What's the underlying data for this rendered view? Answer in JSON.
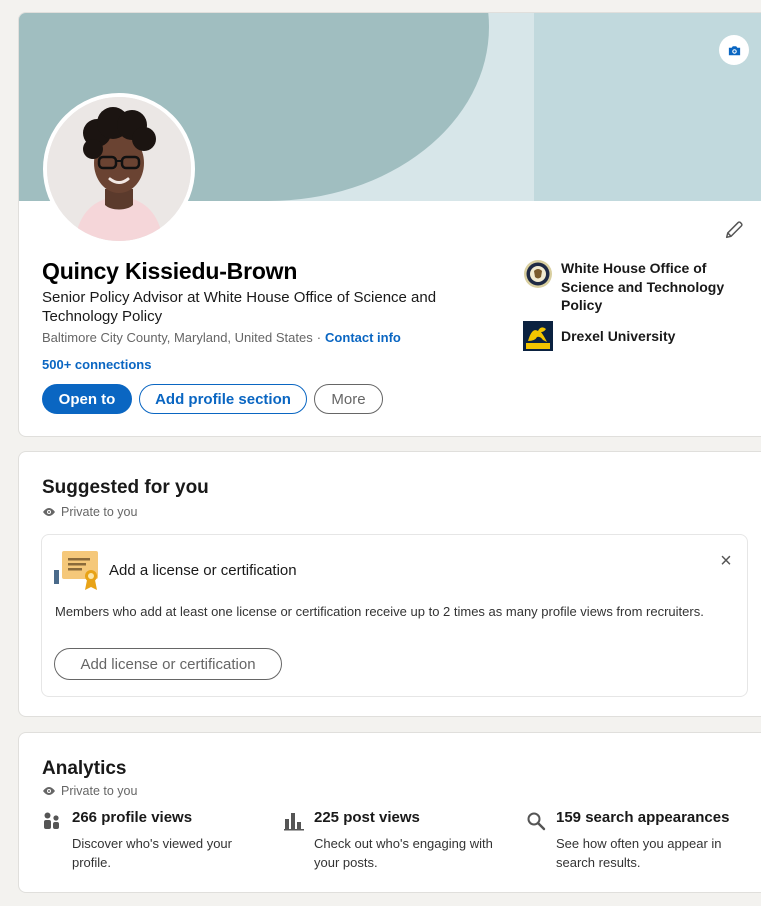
{
  "profile": {
    "name": "Quincy Kissiedu-Brown",
    "headline": "Senior Policy Advisor at White House Office of Science and Technology Policy",
    "location": "Baltimore City County, Maryland, United States",
    "separator": "·",
    "contact_info": "Contact info",
    "connections": "500+ connections",
    "buttons": {
      "open_to": "Open to",
      "add_section": "Add profile section",
      "more": "More"
    },
    "organizations": [
      {
        "name": "White House Office of Science and Technology Policy",
        "logo": "white-house-seal-logo"
      },
      {
        "name": "Drexel University",
        "logo": "drexel-dragon-logo"
      }
    ],
    "icons": {
      "camera": "camera-icon",
      "edit": "pencil-icon"
    },
    "colors": {
      "accent": "#0a66c2",
      "banner": "#a0bec0"
    }
  },
  "suggested": {
    "title": "Suggested for you",
    "private": "Private to you",
    "card": {
      "title": "Add a license or certification",
      "description": "Members who add at least one license or certification receive up to 2 times as many profile views from recruiters.",
      "button": "Add license or certification",
      "close": "×",
      "icon": "certificate-icon"
    }
  },
  "analytics": {
    "title": "Analytics",
    "private": "Private to you",
    "stats": [
      {
        "title": "266 profile views",
        "description": "Discover who's viewed your profile.",
        "icon": "people-icon"
      },
      {
        "title": "225 post views",
        "description": "Check out who's engaging with your posts.",
        "icon": "bar-chart-icon"
      },
      {
        "title": "159 search appearances",
        "description": "See how often you appear in search results.",
        "icon": "search-icon"
      }
    ]
  }
}
